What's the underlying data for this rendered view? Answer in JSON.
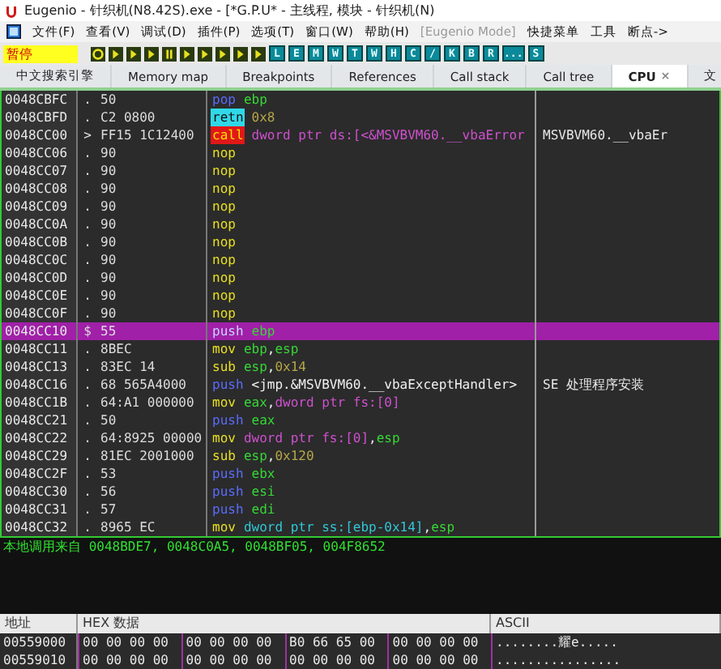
{
  "window": {
    "title": "Eugenio - 针织机(N8.42S).exe - [*G.P.U* - 主线程, 模块 - 针织机(N)"
  },
  "menu": [
    {
      "label": "文件(F)",
      "disabled": false
    },
    {
      "label": "查看(V)",
      "disabled": false
    },
    {
      "label": "调试(D)",
      "disabled": false
    },
    {
      "label": "插件(P)",
      "disabled": false
    },
    {
      "label": "选项(T)",
      "disabled": false
    },
    {
      "label": "窗口(W)",
      "disabled": false
    },
    {
      "label": "帮助(H)",
      "disabled": false
    },
    {
      "label": "[Eugenio Mode]",
      "disabled": true
    },
    {
      "label": "快捷菜单",
      "disabled": false
    },
    {
      "label": "工具",
      "disabled": false
    },
    {
      "label": "断点->",
      "disabled": false
    }
  ],
  "toolbar": {
    "status": "暂停",
    "letters": [
      "L",
      "E",
      "M",
      "W",
      "T",
      "W",
      "H",
      "C",
      "/",
      "K",
      "B",
      "R",
      "...",
      "S"
    ]
  },
  "tabs": [
    {
      "label": "中文搜索引擎",
      "selected": false
    },
    {
      "label": "Memory map",
      "selected": false
    },
    {
      "label": "Breakpoints",
      "selected": false
    },
    {
      "label": "References",
      "selected": false
    },
    {
      "label": "Call stack",
      "selected": false
    },
    {
      "label": "Call tree",
      "selected": false
    },
    {
      "label": "CPU",
      "selected": true,
      "close": "×"
    },
    {
      "label": "文",
      "selected": false
    }
  ],
  "disassembly": [
    {
      "address": "0048CBFC",
      "marker": ".",
      "hex": "50",
      "mnemonic": "pop",
      "kind": "push",
      "operands": [
        {
          "text": "ebp",
          "kind": "reg"
        }
      ],
      "selected": false
    },
    {
      "address": "0048CBFD",
      "marker": ".",
      "hex": "C2 0800",
      "mnemonic": "retn",
      "kind": "ret",
      "operands": [
        {
          "text": "0x8",
          "kind": "num"
        }
      ],
      "selected": false
    },
    {
      "address": "0048CC00",
      "marker": ">",
      "hex": "FF15 1C12400",
      "mnemonic": "call",
      "kind": "call",
      "operands": [
        {
          "text": "dword ptr ds:[<&MSVBVM60.__vbaError",
          "kind": "mem"
        }
      ],
      "comment": "MSVBVM60.__vbaEr",
      "selected": false
    },
    {
      "address": "0048CC06",
      "marker": ".",
      "hex": "90",
      "mnemonic": "nop",
      "kind": "plain",
      "selected": false
    },
    {
      "address": "0048CC07",
      "marker": ".",
      "hex": "90",
      "mnemonic": "nop",
      "kind": "plain",
      "selected": false
    },
    {
      "address": "0048CC08",
      "marker": ".",
      "hex": "90",
      "mnemonic": "nop",
      "kind": "plain",
      "selected": false
    },
    {
      "address": "0048CC09",
      "marker": ".",
      "hex": "90",
      "mnemonic": "nop",
      "kind": "plain",
      "selected": false
    },
    {
      "address": "0048CC0A",
      "marker": ".",
      "hex": "90",
      "mnemonic": "nop",
      "kind": "plain",
      "selected": false
    },
    {
      "address": "0048CC0B",
      "marker": ".",
      "hex": "90",
      "mnemonic": "nop",
      "kind": "plain",
      "selected": false
    },
    {
      "address": "0048CC0C",
      "marker": ".",
      "hex": "90",
      "mnemonic": "nop",
      "kind": "plain",
      "selected": false
    },
    {
      "address": "0048CC0D",
      "marker": ".",
      "hex": "90",
      "mnemonic": "nop",
      "kind": "plain",
      "selected": false
    },
    {
      "address": "0048CC0E",
      "marker": ".",
      "hex": "90",
      "mnemonic": "nop",
      "kind": "plain",
      "selected": false
    },
    {
      "address": "0048CC0F",
      "marker": ".",
      "hex": "90",
      "mnemonic": "nop",
      "kind": "plain",
      "selected": false
    },
    {
      "address": "0048CC10",
      "marker": "$",
      "hex": "55",
      "mnemonic": "push",
      "kind": "push",
      "operands": [
        {
          "text": "ebp",
          "kind": "reg"
        }
      ],
      "selected": true
    },
    {
      "address": "0048CC11",
      "marker": ".",
      "hex": "8BEC",
      "mnemonic": "mov",
      "kind": "plain",
      "operands": [
        {
          "text": "ebp",
          "kind": "reg"
        },
        {
          "text": ",",
          "kind": "sym"
        },
        {
          "text": "esp",
          "kind": "reg"
        }
      ],
      "selected": false
    },
    {
      "address": "0048CC13",
      "marker": ".",
      "hex": "83EC 14",
      "mnemonic": "sub",
      "kind": "plain",
      "operands": [
        {
          "text": "esp",
          "kind": "reg"
        },
        {
          "text": ",",
          "kind": "sym"
        },
        {
          "text": "0x14",
          "kind": "num"
        }
      ],
      "selected": false
    },
    {
      "address": "0048CC16",
      "marker": ".",
      "hex": "68 565A4000",
      "mnemonic": "push",
      "kind": "push",
      "operands": [
        {
          "text": "<jmp.&MSVBVM60.__vbaExceptHandler>",
          "kind": "sym"
        }
      ],
      "comment": "SE 处理程序安装",
      "selected": false
    },
    {
      "address": "0048CC1B",
      "marker": ".",
      "hex": "64:A1 000000",
      "mnemonic": "mov",
      "kind": "plain",
      "operands": [
        {
          "text": "eax",
          "kind": "reg"
        },
        {
          "text": ",",
          "kind": "sym"
        },
        {
          "text": "dword ptr fs:[0]",
          "kind": "mem"
        }
      ],
      "selected": false
    },
    {
      "address": "0048CC21",
      "marker": ".",
      "hex": "50",
      "mnemonic": "push",
      "kind": "push",
      "operands": [
        {
          "text": "eax",
          "kind": "reg"
        }
      ],
      "selected": false
    },
    {
      "address": "0048CC22",
      "marker": ".",
      "hex": "64:8925 00000",
      "mnemonic": "mov",
      "kind": "plain",
      "operands": [
        {
          "text": "dword ptr fs:[0]",
          "kind": "mem"
        },
        {
          "text": ",",
          "kind": "sym"
        },
        {
          "text": "esp",
          "kind": "reg"
        }
      ],
      "selected": false
    },
    {
      "address": "0048CC29",
      "marker": ".",
      "hex": "81EC 2001000",
      "mnemonic": "sub",
      "kind": "plain",
      "operands": [
        {
          "text": "esp",
          "kind": "reg"
        },
        {
          "text": ",",
          "kind": "sym"
        },
        {
          "text": "0x120",
          "kind": "num"
        }
      ],
      "selected": false
    },
    {
      "address": "0048CC2F",
      "marker": ".",
      "hex": "53",
      "mnemonic": "push",
      "kind": "push",
      "operands": [
        {
          "text": "ebx",
          "kind": "reg"
        }
      ],
      "selected": false
    },
    {
      "address": "0048CC30",
      "marker": ".",
      "hex": "56",
      "mnemonic": "push",
      "kind": "push",
      "operands": [
        {
          "text": "esi",
          "kind": "reg"
        }
      ],
      "selected": false
    },
    {
      "address": "0048CC31",
      "marker": ".",
      "hex": "57",
      "mnemonic": "push",
      "kind": "push",
      "operands": [
        {
          "text": "edi",
          "kind": "reg"
        }
      ],
      "selected": false
    },
    {
      "address": "0048CC32",
      "marker": ".",
      "hex": "8965 EC",
      "mnemonic": "mov",
      "kind": "plain",
      "operands": [
        {
          "text": "dword ptr ss:[ebp-0x14]",
          "kind": "stack"
        },
        {
          "text": ",",
          "kind": "sym"
        },
        {
          "text": "esp",
          "kind": "reg"
        }
      ],
      "selected": false
    }
  ],
  "info_line": "本地调用来自 0048BDE7, 0048C0A5, 0048BF05, 004F8652",
  "dump": {
    "columns": [
      "地址",
      "HEX 数据",
      "ASCII"
    ],
    "rows": [
      {
        "address": "00559000",
        "groups": [
          "00 00 00 00",
          "00 00 00 00",
          "B0 66 65 00",
          "00 00 00 00"
        ],
        "ascii": "........耀e....."
      },
      {
        "address": "00559010",
        "groups": [
          "00 00 00 00",
          "00 00 00 00",
          "00 00 00 00",
          "00 00 00 00"
        ],
        "ascii": "................"
      }
    ]
  }
}
